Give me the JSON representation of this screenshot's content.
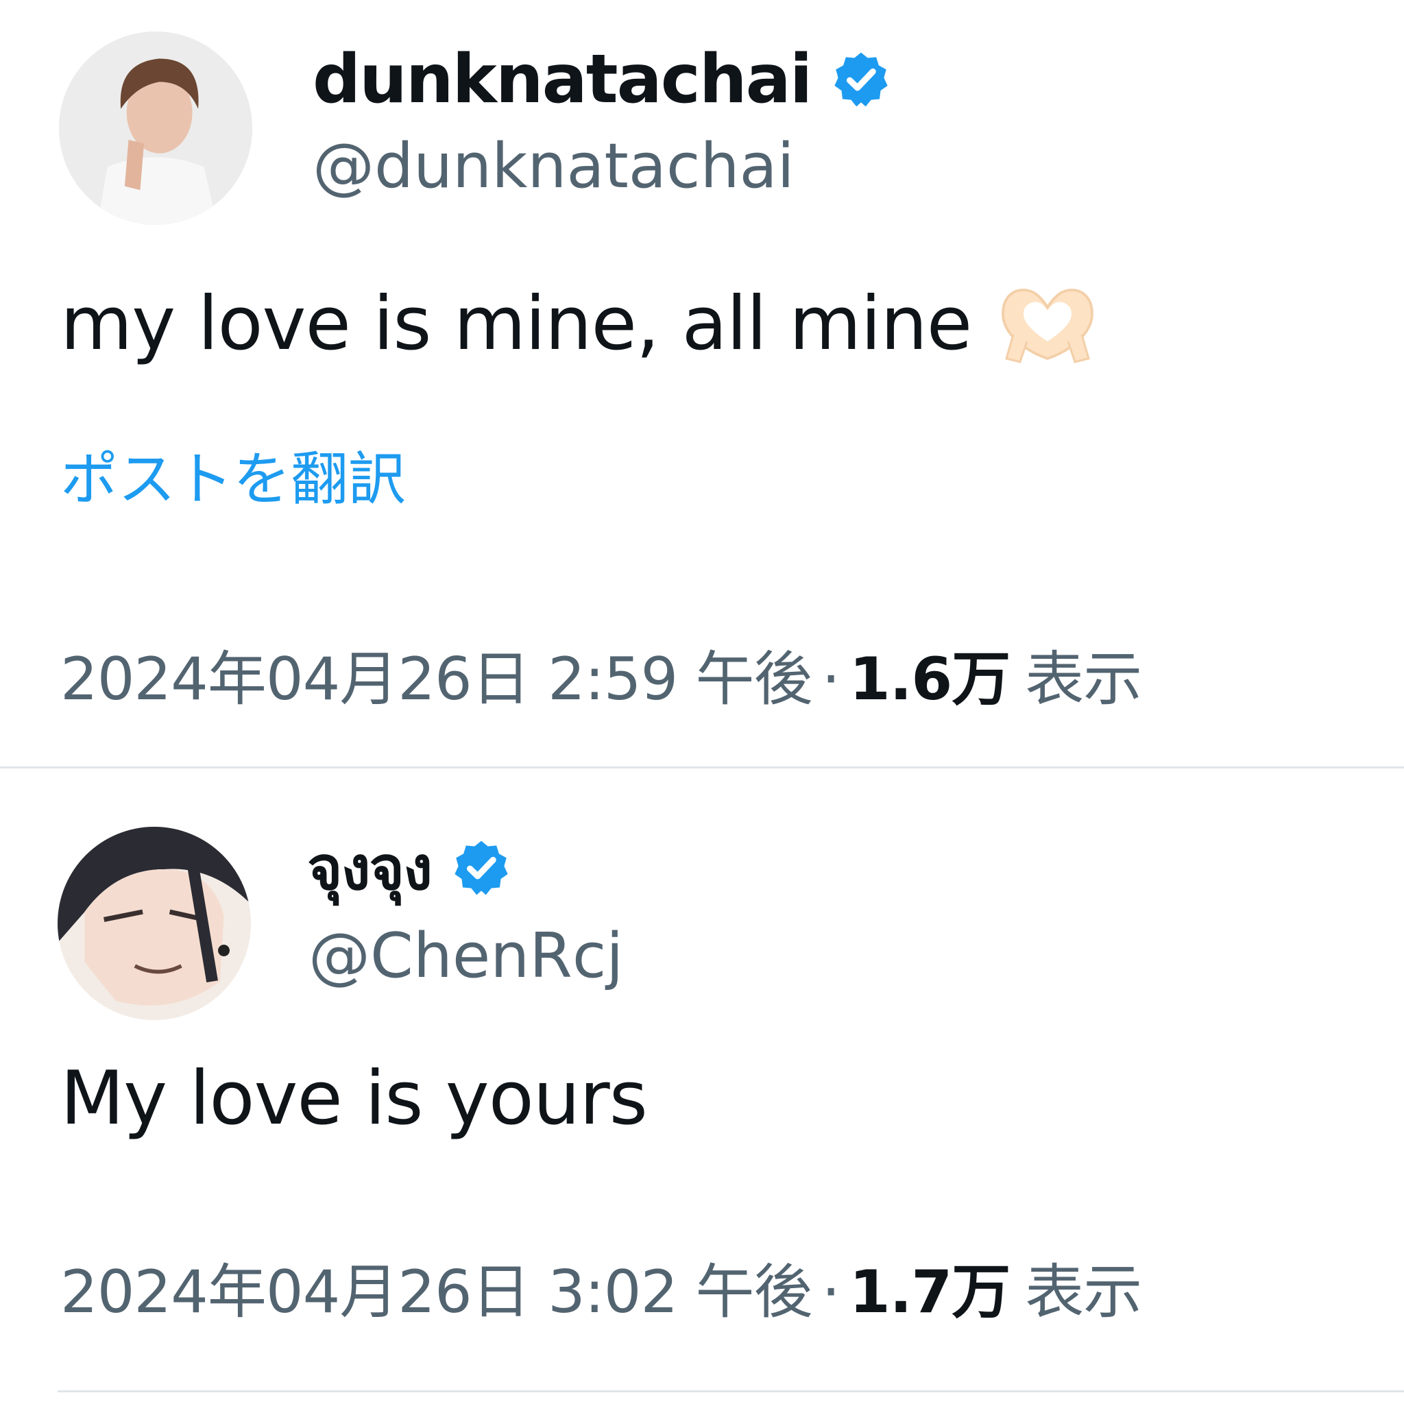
{
  "posts": [
    {
      "display_name": "dunknatachai",
      "handle": "@dunknatachai",
      "verified": true,
      "text": "my love is mine, all mine",
      "emoji": "heart-hands",
      "translate_label": "ポストを翻訳",
      "timestamp": "2024年04月26日 2:59 午後",
      "separator": "·",
      "views_count": "1.6万",
      "views_label": "表示"
    },
    {
      "display_name": "จุงจุง",
      "handle": "@ChenRcj",
      "verified": true,
      "text": "My love is yours",
      "timestamp": "2024年04月26日 3:02 午後",
      "separator": "·",
      "views_count": "1.7万",
      "views_label": "表示"
    }
  ],
  "colors": {
    "text_primary": "#0f1419",
    "text_secondary": "#536471",
    "link": "#1d9bf0",
    "verified": "#1d9bf0",
    "divider": "#e1e5e8"
  },
  "icons": {
    "verified": "verified-badge-icon",
    "emoji": "heart-hands-icon"
  }
}
